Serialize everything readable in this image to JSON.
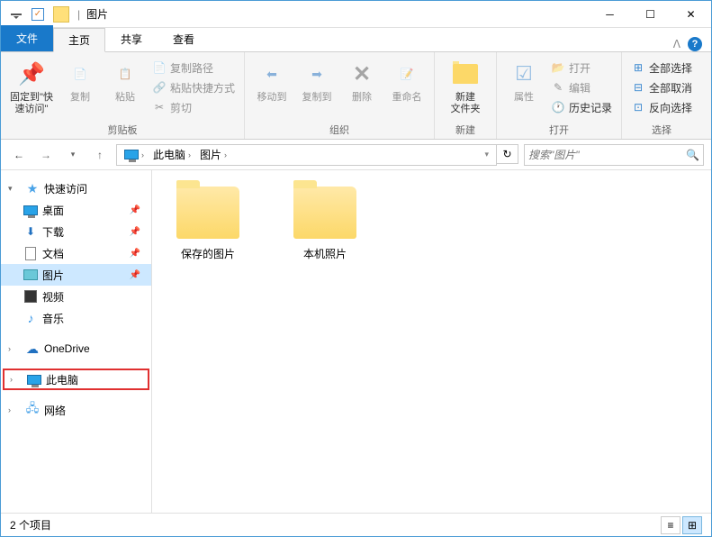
{
  "window": {
    "title": "图片"
  },
  "tabs": {
    "file": "文件",
    "home": "主页",
    "share": "共享",
    "view": "查看"
  },
  "ribbon": {
    "clipboard": {
      "label": "剪贴板",
      "pin": "固定到\"快\n速访问\"",
      "copy": "复制",
      "paste": "粘贴",
      "copypath": "复制路径",
      "shortcut": "粘贴快捷方式",
      "cut": "剪切"
    },
    "organize": {
      "label": "组织",
      "moveto": "移动到",
      "copyto": "复制到",
      "delete": "删除",
      "rename": "重命名"
    },
    "new": {
      "label": "新建",
      "newfolder": "新建\n文件夹"
    },
    "open": {
      "label": "打开",
      "properties": "属性",
      "open": "打开",
      "edit": "编辑",
      "history": "历史记录"
    },
    "select": {
      "label": "选择",
      "selectall": "全部选择",
      "selectnone": "全部取消",
      "invert": "反向选择"
    }
  },
  "breadcrumb": {
    "root": "此电脑",
    "current": "图片"
  },
  "search": {
    "placeholder": "搜索\"图片\""
  },
  "sidebar": {
    "quickaccess": "快速访问",
    "desktop": "桌面",
    "downloads": "下载",
    "documents": "文档",
    "pictures": "图片",
    "videos": "视频",
    "music": "音乐",
    "onedrive": "OneDrive",
    "thispc": "此电脑",
    "network": "网络"
  },
  "folders": [
    {
      "name": "保存的图片"
    },
    {
      "name": "本机照片"
    }
  ],
  "status": {
    "count": "2 个项目"
  }
}
